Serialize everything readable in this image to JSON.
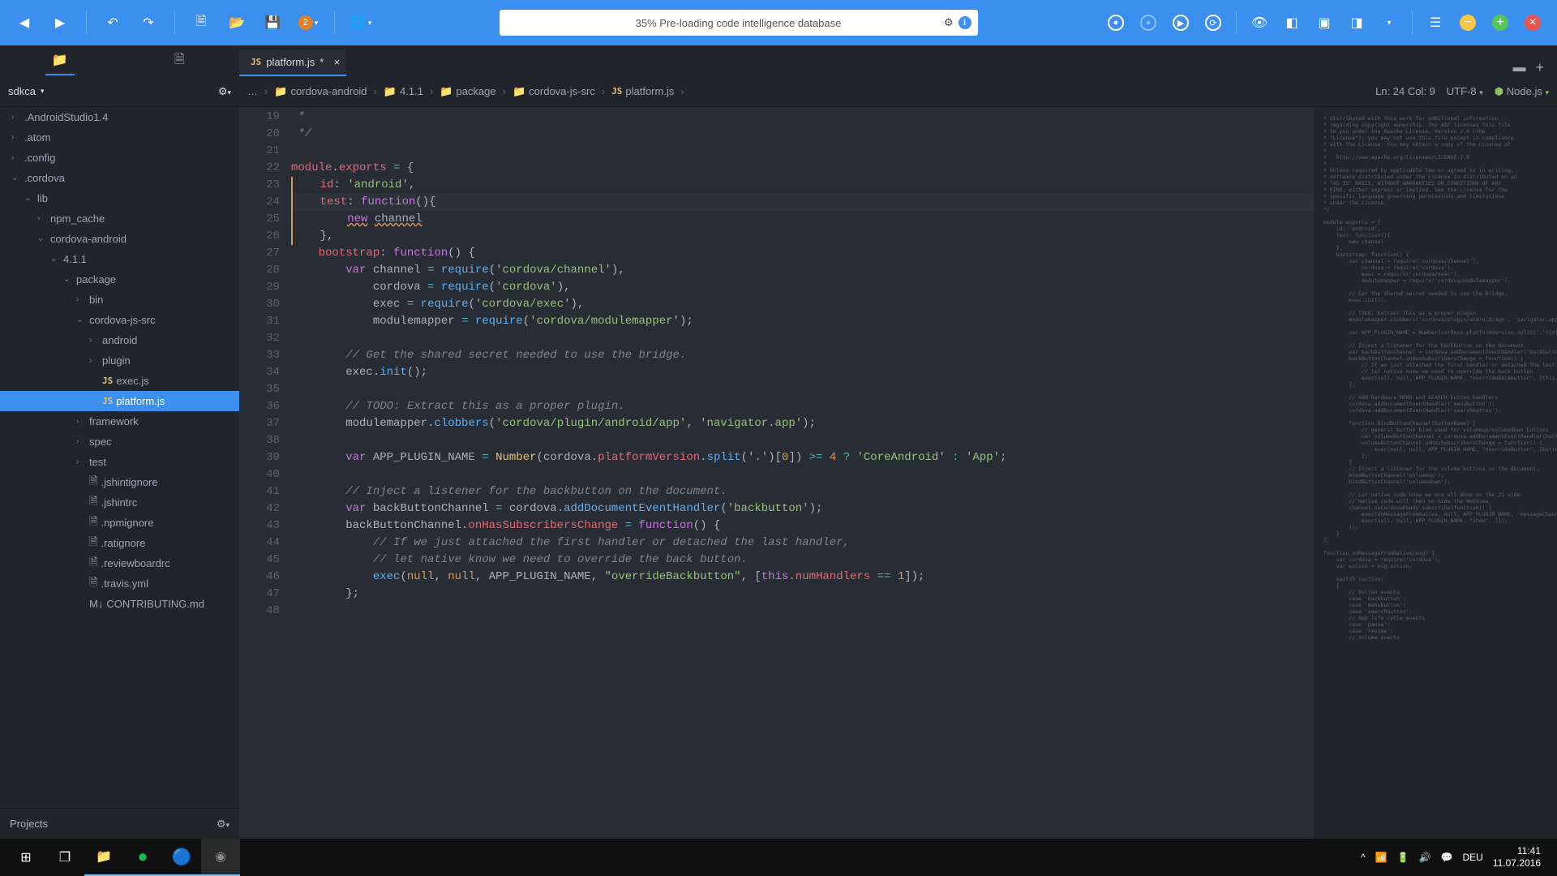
{
  "toolbar": {
    "preload_text": "35% Pre-loading code intelligence database"
  },
  "tabs": {
    "active_file": "platform.js",
    "modified": "*"
  },
  "sidebar": {
    "project_name": "sdkca",
    "footer_label": "Projects",
    "items": [
      {
        "name": ".AndroidStudio1.4",
        "depth": 0,
        "chev": ">",
        "type": "folder"
      },
      {
        "name": ".atom",
        "depth": 0,
        "chev": ">",
        "type": "folder"
      },
      {
        "name": ".config",
        "depth": 0,
        "chev": ">",
        "type": "folder"
      },
      {
        "name": ".cordova",
        "depth": 0,
        "chev": "v",
        "type": "folder"
      },
      {
        "name": "lib",
        "depth": 1,
        "chev": "v",
        "type": "folder"
      },
      {
        "name": "npm_cache",
        "depth": 2,
        "chev": ">",
        "type": "folder"
      },
      {
        "name": "cordova-android",
        "depth": 2,
        "chev": "v",
        "type": "folder"
      },
      {
        "name": "4.1.1",
        "depth": 3,
        "chev": "v",
        "type": "folder"
      },
      {
        "name": "package",
        "depth": 4,
        "chev": "v",
        "type": "folder"
      },
      {
        "name": "bin",
        "depth": 5,
        "chev": ">",
        "type": "folder"
      },
      {
        "name": "cordova-js-src",
        "depth": 5,
        "chev": "v",
        "type": "folder"
      },
      {
        "name": "android",
        "depth": 6,
        "chev": ">",
        "type": "folder"
      },
      {
        "name": "plugin",
        "depth": 6,
        "chev": ">",
        "type": "folder"
      },
      {
        "name": "exec.js",
        "depth": 6,
        "chev": "",
        "type": "js"
      },
      {
        "name": "platform.js",
        "depth": 6,
        "chev": "",
        "type": "js",
        "selected": true
      },
      {
        "name": "framework",
        "depth": 5,
        "chev": ">",
        "type": "folder"
      },
      {
        "name": "spec",
        "depth": 5,
        "chev": ">",
        "type": "folder"
      },
      {
        "name": "test",
        "depth": 5,
        "chev": ">",
        "type": "folder"
      },
      {
        "name": ".jshintignore",
        "depth": 5,
        "chev": "",
        "type": "file"
      },
      {
        "name": ".jshintrc",
        "depth": 5,
        "chev": "",
        "type": "file"
      },
      {
        "name": ".npmignore",
        "depth": 5,
        "chev": "",
        "type": "file"
      },
      {
        "name": ".ratignore",
        "depth": 5,
        "chev": "",
        "type": "file"
      },
      {
        "name": ".reviewboardrc",
        "depth": 5,
        "chev": "",
        "type": "file"
      },
      {
        "name": ".travis.yml",
        "depth": 5,
        "chev": "",
        "type": "file"
      },
      {
        "name": "CONTRIBUTING.md",
        "depth": 5,
        "chev": "",
        "type": "md"
      }
    ]
  },
  "breadcrumb": {
    "items": [
      "cordova-android",
      "4.1.1",
      "package",
      "cordova-js-src",
      "platform.js"
    ],
    "status": "Ln: 24 Col: 9",
    "encoding": "UTF-8",
    "runtime": "Node.js"
  },
  "editor": {
    "lines": [
      {
        "n": 19,
        "html": "<span class='tok-cm'> *</span>"
      },
      {
        "n": 20,
        "html": "<span class='tok-cm'> */</span>"
      },
      {
        "n": 21,
        "html": ""
      },
      {
        "n": 22,
        "fold": "▾",
        "html": "<span class='tok-prop'>module</span>.<span class='tok-prop'>exports</span> <span class='tok-op'>=</span> {"
      },
      {
        "n": 23,
        "mod": true,
        "html": "    <span class='tok-prop'>id</span>: <span class='tok-str'>'android'</span>,"
      },
      {
        "n": 24,
        "fold": "▾",
        "hl": true,
        "mod": true,
        "html": "    <span class='tok-prop'>test</span>: <span class='tok-kw'>function</span>(){"
      },
      {
        "n": 25,
        "mod": true,
        "html": "        <span class='tok-kw' style='text-decoration:underline wavy #d19a66'>new</span> <span class='tok-def' style='text-decoration:underline wavy #d19a66'>channel</span>"
      },
      {
        "n": 26,
        "mod": true,
        "html": "    },"
      },
      {
        "n": 27,
        "fold": "▾",
        "html": "    <span class='tok-prop'>bootstrap</span>: <span class='tok-kw'>function</span>() {"
      },
      {
        "n": 28,
        "html": "        <span class='tok-kw'>var</span> <span class='tok-def'>channel</span> <span class='tok-op'>=</span> <span class='tok-fn'>require</span>(<span class='tok-str'>'cordova/channel'</span>),"
      },
      {
        "n": 29,
        "html": "            <span class='tok-def'>cordova</span> <span class='tok-op'>=</span> <span class='tok-fn'>require</span>(<span class='tok-str'>'cordova'</span>),"
      },
      {
        "n": 30,
        "html": "            <span class='tok-def'>exec</span> <span class='tok-op'>=</span> <span class='tok-fn'>require</span>(<span class='tok-str'>'cordova/exec'</span>),"
      },
      {
        "n": 31,
        "html": "            <span class='tok-def'>modulemapper</span> <span class='tok-op'>=</span> <span class='tok-fn'>require</span>(<span class='tok-str'>'cordova/modulemapper'</span>);"
      },
      {
        "n": 32,
        "html": ""
      },
      {
        "n": 33,
        "html": "        <span class='tok-cm'>// Get the shared secret needed to use the bridge.</span>"
      },
      {
        "n": 34,
        "html": "        <span class='tok-def'>exec</span>.<span class='tok-fn'>init</span>();"
      },
      {
        "n": 35,
        "html": ""
      },
      {
        "n": 36,
        "html": "        <span class='tok-cm'>// TODO: Extract this as a proper plugin.</span>"
      },
      {
        "n": 37,
        "html": "        <span class='tok-def'>modulemapper</span>.<span class='tok-fn'>clobbers</span>(<span class='tok-str'>'cordova/plugin/android/app'</span>, <span class='tok-str'>'navigator.app'</span>);"
      },
      {
        "n": 38,
        "html": ""
      },
      {
        "n": 39,
        "html": "        <span class='tok-kw'>var</span> <span class='tok-def'>APP_PLUGIN_NAME</span> <span class='tok-op'>=</span> <span class='tok-id'>Number</span>(<span class='tok-def'>cordova</span>.<span class='tok-prop'>platformVersion</span>.<span class='tok-fn'>split</span>(<span class='tok-str'>'.'</span>)[<span class='tok-num'>0</span>]) <span class='tok-op'>&gt;=</span> <span class='tok-num'>4</span> <span class='tok-op'>?</span> <span class='tok-str'>'CoreAndroid'</span> <span class='tok-op'>:</span> <span class='tok-str'>'App'</span>;"
      },
      {
        "n": 40,
        "html": ""
      },
      {
        "n": 41,
        "html": "        <span class='tok-cm'>// Inject a listener for the backbutton on the document.</span>"
      },
      {
        "n": 42,
        "html": "        <span class='tok-kw'>var</span> <span class='tok-def'>backButtonChannel</span> <span class='tok-op'>=</span> <span class='tok-def'>cordova</span>.<span class='tok-fn'>addDocumentEventHandler</span>(<span class='tok-str'>'backbutton'</span>);"
      },
      {
        "n": 43,
        "fold": "▾",
        "html": "        <span class='tok-def'>backButtonChannel</span>.<span class='tok-prop'>onHasSubscribersChange</span> <span class='tok-op'>=</span> <span class='tok-kw'>function</span>() {"
      },
      {
        "n": 44,
        "html": "            <span class='tok-cm'>// If we just attached the first handler or detached the last handler,</span>"
      },
      {
        "n": 45,
        "html": "            <span class='tok-cm'>// let native know we need to override the back button.</span>"
      },
      {
        "n": 46,
        "html": "            <span class='tok-fn'>exec</span>(<span class='tok-num'>null</span>, <span class='tok-num'>null</span>, <span class='tok-def'>APP_PLUGIN_NAME</span>, <span class='tok-str'>\"overrideBackbutton\"</span>, [<span class='tok-kw'>this</span>.<span class='tok-prop'>numHandlers</span> <span class='tok-op'>==</span> <span class='tok-num'>1</span>]);"
      },
      {
        "n": 47,
        "html": "        };"
      },
      {
        "n": 48,
        "html": ""
      }
    ]
  },
  "minimap_text": "* distributed with this work for additional information\n* regarding copyright ownership. The ASF licenses this file\n* to you under the Apache License, Version 2.0 (the\n* \"License\"); you may not use this file except in compliance\n* with the License. You may obtain a copy of the License at\n*\n*   http://www.apache.org/licenses/LICENSE-2.0\n*\n* Unless required by applicable law or agreed to in writing,\n* software distributed under the License is distributed on an\n* \"AS IS\" BASIS, WITHOUT WARRANTIES OR CONDITIONS OF ANY\n* KIND, either express or implied. See the License for the\n* specific language governing permissions and limitations\n* under the License.\n*/\n\nmodule.exports = {\n    id: 'android',\n    test: function(){\n        new channel\n    },\n    bootstrap: function() {\n        var channel = require('cordova/channel'),\n            cordova = require('cordova'),\n            exec = require('cordova/exec'),\n            modulemapper = require('cordova/modulemapper');\n\n        // Get the shared secret needed to use the bridge.\n        exec.init();\n\n        // TODO: Extract this as a proper plugin.\n        modulemapper.clobbers('cordova/plugin/android/app', 'navigator.app');\n\n        var APP_PLUGIN_NAME = Number(cordova.platformVersion.split('.')[0]) >= 4 ? 'CoreAndroid' : 'App';\n\n        // Inject a listener for the backbutton on the document.\n        var backButtonChannel = cordova.addDocumentEventHandler('backbutton');\n        backButtonChannel.onHasSubscribersChange = function() {\n            // If we just attached the first handler or detached the last\n            // let native know we need to override the back button.\n            exec(null, null, APP_PLUGIN_NAME, \"overrideBackbutton\", [this.numHandlers == 1]);\n        };\n\n        // Add hardware MENU and SEARCH button handlers\n        cordova.addDocumentEventHandler('menubutton');\n        cordova.addDocumentEventHandler('searchbutton');\n\n        function bindButtonChannel(buttonName) {\n            // generic button bind used for volumeup/volumedown buttons\n            var volumeButtonChannel = cordova.addDocumentEventHandler(buttonName + 'button');\n            volumeButtonChannel.onHasSubscribersChange = function() {\n                exec(null, null, APP_PLUGIN_NAME, \"overrideButton\", [buttonName, this.numHandlers == 1]);\n            };\n        }\n        // Inject a listener for the volume buttons on the document.\n        bindButtonChannel('volumeup');\n        bindButtonChannel('volumedown');\n\n        // Let native code know we are all done on the JS side.\n        // Native code will then un-hide the WebView.\n        channel.onCordovaReady.subscribe(function() {\n            exec(onMessageFromNative, null, APP_PLUGIN_NAME, 'messageChannel', []);\n            exec(null, null, APP_PLUGIN_NAME, \"show\", []);\n        });\n    }\n};\n\nfunction onMessageFromNative(msg) {\n    var cordova = require('cordova');\n    var action = msg.action;\n\n    switch (action)\n    {\n        // Button events\n        case 'backbutton':\n        case 'menubutton':\n        case 'searchbutton':\n        // App life cycle events\n        case 'pause':\n        case 'resume':\n        // Volume events",
  "taskbar": {
    "lang": "DEU",
    "time": "11:41",
    "date": "11.07.2016"
  }
}
